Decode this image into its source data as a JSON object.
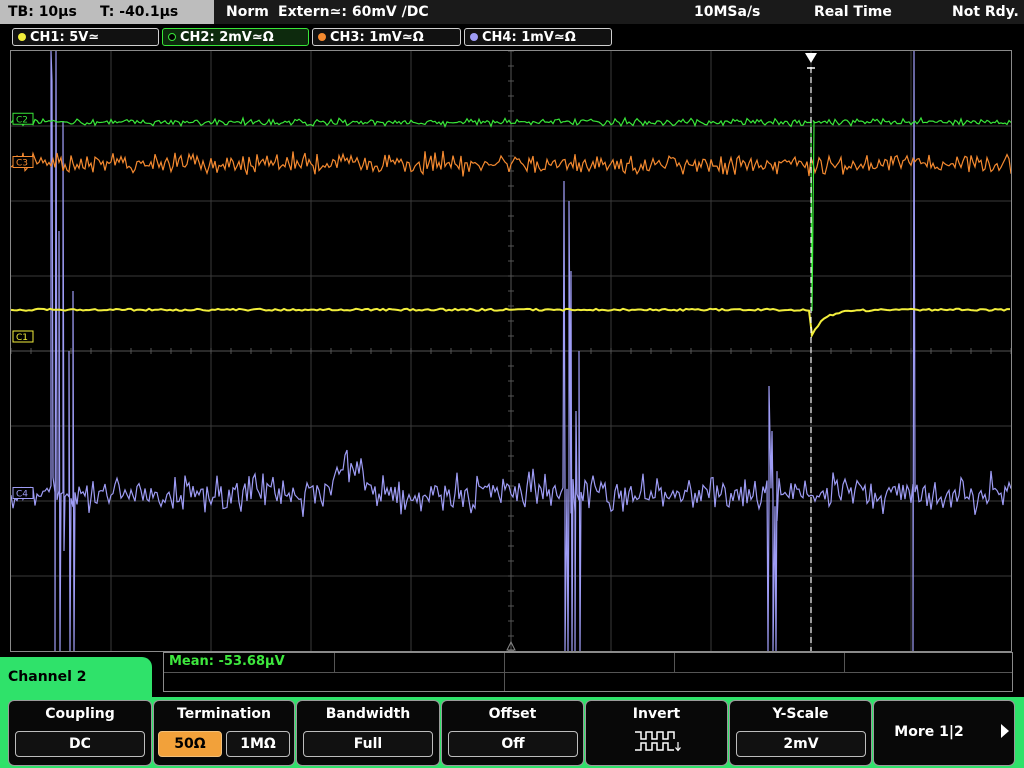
{
  "status": {
    "tb": "TB: 10µs",
    "t": "T: -40.1µs",
    "mode": "Norm",
    "trigger": "Extern≃: 60mV ∕DC",
    "sample_rate": "10MSa/s",
    "acq": "Real Time",
    "ready": "Not Rdy."
  },
  "channels": [
    {
      "label": "CH1: 5V≃",
      "color": "#f2ee3c"
    },
    {
      "label": "CH2: 2mV≃Ω",
      "color": "#39e639"
    },
    {
      "label": "CH3: 1mV≃Ω",
      "color": "#f58a30"
    },
    {
      "label": "CH4: 1mV≃Ω",
      "color": "#9e9cf5"
    }
  ],
  "markers": {
    "c1": "C1",
    "c2": "C2",
    "c3": "C3",
    "c4": "C4"
  },
  "measurement": {
    "text": "Mean: -53.68µV"
  },
  "menu": {
    "title": "Channel 2",
    "coupling": {
      "title": "Coupling",
      "value": "DC"
    },
    "termination": {
      "title": "Termination",
      "opt1": "50Ω",
      "opt2": "1MΩ"
    },
    "bandwidth": {
      "title": "Bandwidth",
      "value": "Full"
    },
    "offset": {
      "title": "Offset",
      "value": "Off"
    },
    "invert": {
      "title": "Invert",
      "icon": "inverted-square-wave-icon"
    },
    "yscale": {
      "title": "Y-Scale",
      "value": "2mV"
    },
    "more": {
      "label": "More 1|2"
    }
  },
  "chart_data": {
    "type": "line",
    "grid": {
      "x_divisions": 10,
      "y_divisions": 8,
      "on": true
    },
    "trigger_x_div": 8.0,
    "series": [
      {
        "name": "CH1",
        "color": "#f2ee3c",
        "baseline_div": 3.45
      },
      {
        "name": "CH2",
        "color": "#39e639",
        "baseline_div": 0.95
      },
      {
        "name": "CH3",
        "color": "#f58a30",
        "baseline_div": 1.5
      },
      {
        "name": "CH4",
        "color": "#9e9cf5",
        "baseline_div": 5.9
      }
    ]
  }
}
